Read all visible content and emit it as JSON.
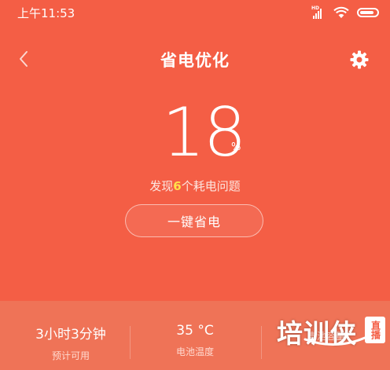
{
  "status_bar": {
    "time": "上午11:53",
    "network_label": "HD",
    "battery_level": 0.85
  },
  "header": {
    "title": "省电优化",
    "back_icon": "chevron-left-icon",
    "settings_icon": "gear-icon"
  },
  "score": {
    "value": "18",
    "unit": "%"
  },
  "issues": {
    "prefix": "发现",
    "count": "6",
    "suffix": "个耗电问题"
  },
  "optimize_button": {
    "label": "一键省电"
  },
  "stats": [
    {
      "value": "3小时3分钟",
      "label": "预计可用"
    },
    {
      "value": "35 °C",
      "label": "电池温度"
    },
    {
      "value": "",
      "label": "电池容量"
    }
  ],
  "watermark": {
    "text": "培训侠",
    "badge": "直播"
  },
  "colors": {
    "background": "#f45e45",
    "stats_background": "#ef7357",
    "highlight": "#ffe14a"
  }
}
